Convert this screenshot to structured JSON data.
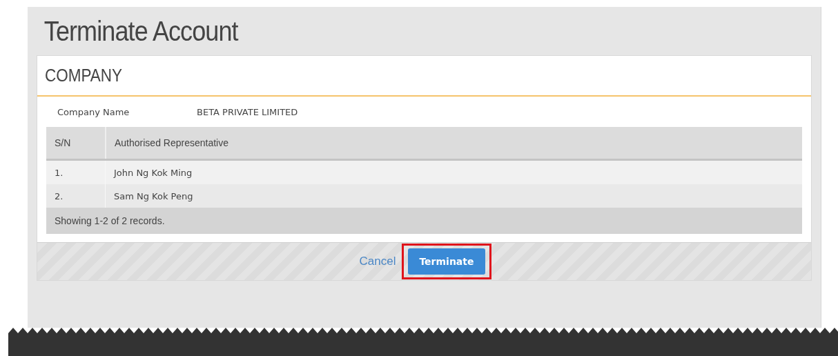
{
  "page": {
    "title": "Terminate Account"
  },
  "section": {
    "heading": "COMPANY",
    "fields": [
      {
        "label": "Company Name",
        "value": "BETA PRIVATE LIMITED"
      }
    ],
    "table": {
      "columns": [
        "S/N",
        "Authorised Representative"
      ],
      "rows": [
        {
          "cells": [
            "1.",
            "John Ng Kok Ming"
          ]
        },
        {
          "cells": [
            "2.",
            "Sam Ng Kok Peng"
          ]
        }
      ],
      "footer": "Showing 1-2 of 2 records."
    }
  },
  "actions": [
    {
      "kind": "link",
      "label": "Cancel",
      "highlighted": false
    },
    {
      "kind": "primary",
      "label": "Terminate",
      "highlighted": true
    }
  ]
}
